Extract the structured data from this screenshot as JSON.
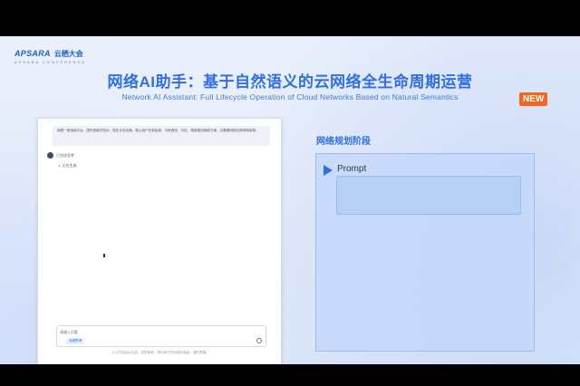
{
  "header": {
    "logo_brand": "APSARA",
    "logo_cn": "云栖大会",
    "logo_sub": "APSARA CONFERENCE",
    "title_cn": "网络AI助手：基于自然语义的云网络全生命周期运营",
    "title_en": "Network AI Assistant: Full Lifecycle Operation of Cloud Networks Based on Natural Semantics",
    "badge": "NEW"
  },
  "chat": {
    "user_message": "我是一家电商平台，国内首家在杭州、现在计划出海，核心用户在新加坡、马来西亚、印尼，帮我规划网络方案，并看看网络互联网络架构。",
    "ai_status": "已完成思考",
    "ai_step": "1. 正在生成",
    "input_placeholder": "请输入问题",
    "chip_label": "深度思考",
    "footer_note": "以上内容由AI生成，仅供参考，请勿用于任何商业用途，谨防受骗。"
  },
  "right_panel": {
    "phase_title": "网络规划阶段",
    "prompt_label": "Prompt"
  },
  "colors": {
    "accent": "#2f6fe4",
    "badge": "#f2661f",
    "panel_bg": "#c6d8fa"
  },
  "icons": {
    "prompt_arrow": "play-triangle-icon",
    "ai_avatar": "assistant-avatar-icon",
    "send": "send-icon"
  }
}
